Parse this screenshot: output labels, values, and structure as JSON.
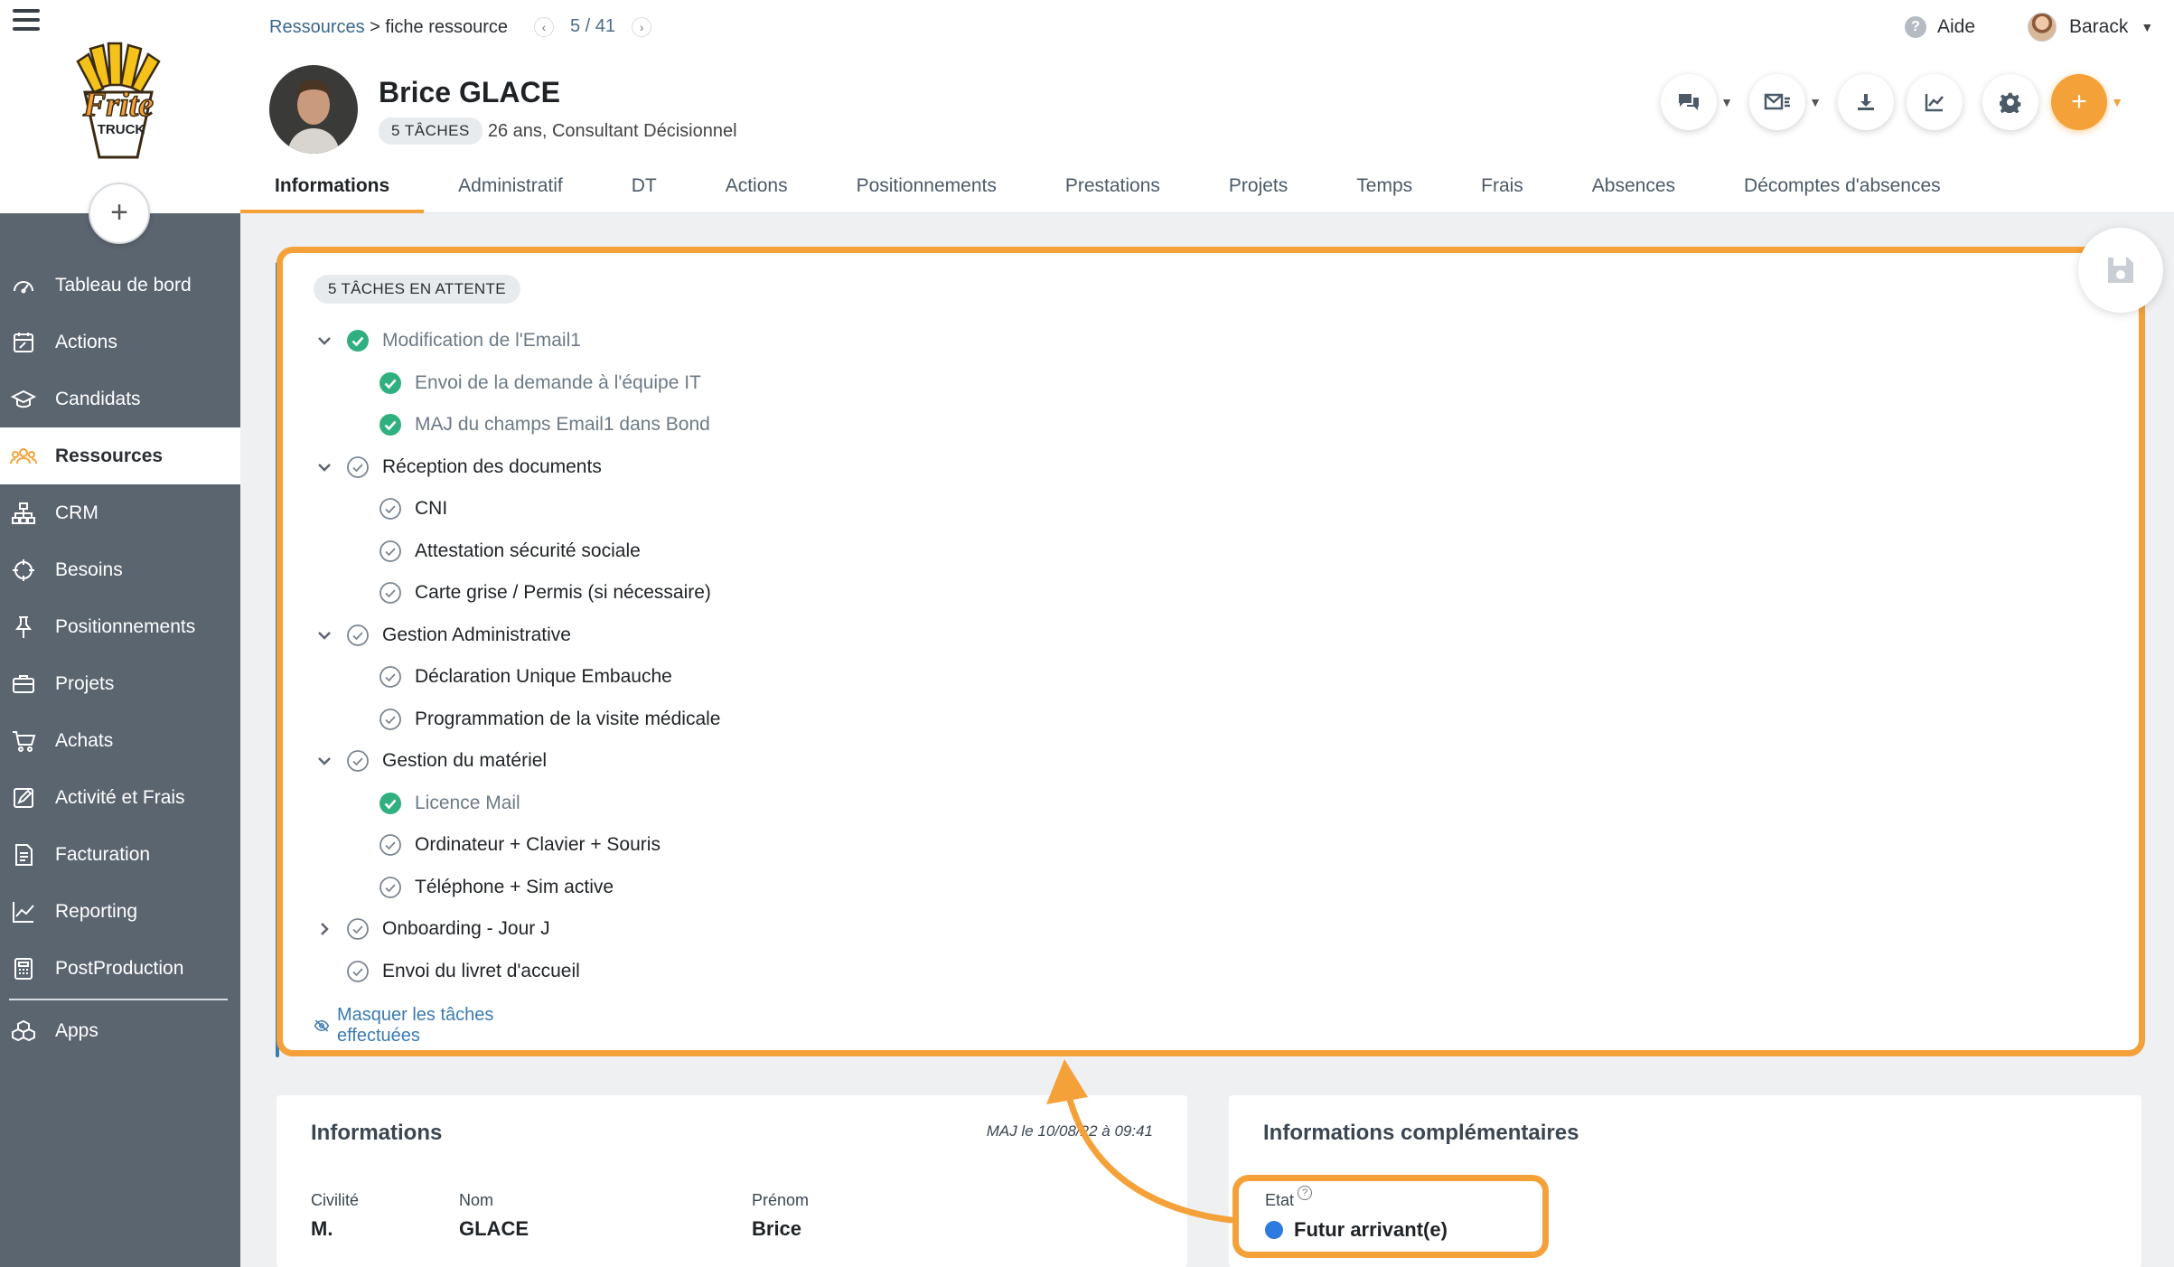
{
  "app": {
    "logo_text_top": "Frite",
    "logo_text_bottom": "TRUCK"
  },
  "sidebar": {
    "items": [
      {
        "label": "Tableau de bord",
        "icon": "dashboard-gauge-icon"
      },
      {
        "label": "Actions",
        "icon": "calendar-edit-icon"
      },
      {
        "label": "Candidats",
        "icon": "graduation-cap-icon"
      },
      {
        "label": "Ressources",
        "icon": "users-group-icon",
        "active": true
      },
      {
        "label": "CRM",
        "icon": "org-chart-icon"
      },
      {
        "label": "Besoins",
        "icon": "crosshair-icon"
      },
      {
        "label": "Positionnements",
        "icon": "pin-icon"
      },
      {
        "label": "Projets",
        "icon": "briefcase-icon"
      },
      {
        "label": "Achats",
        "icon": "cart-icon"
      },
      {
        "label": "Activité et Frais",
        "icon": "edit-square-icon"
      },
      {
        "label": "Facturation",
        "icon": "invoice-icon"
      },
      {
        "label": "Reporting",
        "icon": "line-chart-icon"
      },
      {
        "label": "PostProduction",
        "icon": "calculator-icon"
      },
      {
        "label": "Apps",
        "icon": "cubes-icon"
      }
    ]
  },
  "header": {
    "breadcrumb_root": "Ressources",
    "breadcrumb_sep": ">",
    "breadcrumb_current": "fiche ressource",
    "pager": "5 / 41",
    "help": "Aide",
    "user_name": "Barack"
  },
  "profile": {
    "name": "Brice GLACE",
    "tasks_badge": "5 TÂCHES",
    "subtitle": "26 ans, Consultant Décisionnel"
  },
  "tabs": [
    {
      "label": "Informations",
      "active": true
    },
    {
      "label": "Administratif"
    },
    {
      "label": "DT"
    },
    {
      "label": "Actions"
    },
    {
      "label": "Positionnements"
    },
    {
      "label": "Prestations"
    },
    {
      "label": "Projets"
    },
    {
      "label": "Temps"
    },
    {
      "label": "Frais"
    },
    {
      "label": "Absences"
    },
    {
      "label": "Décomptes d'absences"
    }
  ],
  "tasks": {
    "badge": "5 TÂCHES EN ATTENTE",
    "items": [
      {
        "label": "Modification de l'Email1",
        "level": 0,
        "done": true,
        "chevron": "down"
      },
      {
        "label": "Envoi de la demande à l'équipe IT",
        "level": 1,
        "done": true
      },
      {
        "label": "MAJ du champs Email1 dans Bond",
        "level": 1,
        "done": true
      },
      {
        "label": "Réception des documents",
        "level": 0,
        "done": false,
        "chevron": "down"
      },
      {
        "label": "CNI",
        "level": 1,
        "done": false
      },
      {
        "label": "Attestation sécurité sociale",
        "level": 1,
        "done": false
      },
      {
        "label": "Carte grise / Permis (si nécessaire)",
        "level": 1,
        "done": false
      },
      {
        "label": "Gestion Administrative",
        "level": 0,
        "done": false,
        "chevron": "down"
      },
      {
        "label": "Déclaration Unique Embauche",
        "level": 1,
        "done": false
      },
      {
        "label": "Programmation de la visite médicale",
        "level": 1,
        "done": false
      },
      {
        "label": "Gestion du matériel",
        "level": 0,
        "done": false,
        "chevron": "down"
      },
      {
        "label": "Licence Mail",
        "level": 1,
        "done": true
      },
      {
        "label": "Ordinateur + Clavier + Souris",
        "level": 1,
        "done": false
      },
      {
        "label": "Téléphone + Sim active",
        "level": 1,
        "done": false
      },
      {
        "label": "Onboarding - Jour J",
        "level": 0,
        "done": false,
        "chevron": "right"
      },
      {
        "label": "Envoi du livret d'accueil",
        "level": 0,
        "done": false,
        "chevron": "none"
      }
    ],
    "hide_link": "Masquer les tâches effectuées"
  },
  "info_card": {
    "title": "Informations",
    "meta": "MAJ le 10/08/22 à 09:41",
    "fields": [
      {
        "label": "Civilité",
        "value": "M."
      },
      {
        "label": "Nom",
        "value": "GLACE"
      },
      {
        "label": "Prénom",
        "value": "Brice"
      }
    ]
  },
  "extra_card": {
    "title": "Informations complémentaires",
    "etat_label": "Etat",
    "etat_help": "?",
    "etat_value": "Futur arrivant(e)"
  },
  "colors": {
    "accent": "#f5a13a",
    "sidebar": "#5b6570",
    "done_check": "#2fb07e",
    "link": "#3a7bb0",
    "status_dot": "#2e7be0"
  }
}
